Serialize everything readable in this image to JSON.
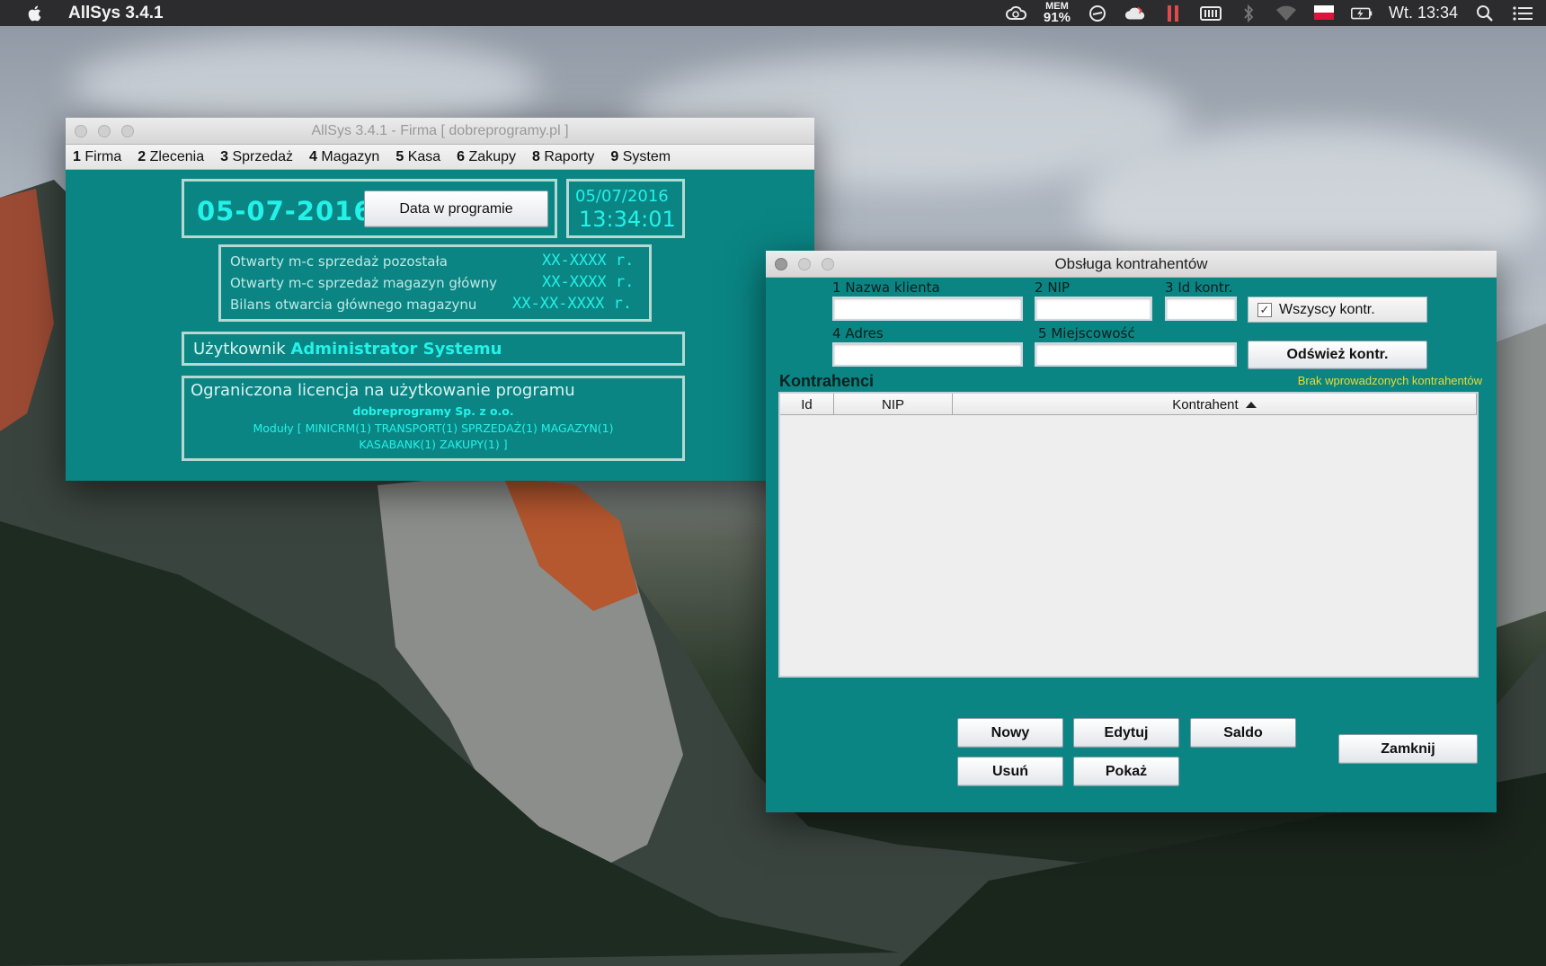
{
  "menubar": {
    "app_name": "AllSys 3.4.1",
    "mem_label": "MEM",
    "mem_value": "91%",
    "clock": "Wt. 13:34",
    "icons": [
      "apple-icon",
      "creative-cloud-icon",
      "sync-icon",
      "cloud-icon",
      "pause-icon",
      "battery-monitor-icon",
      "bluetooth-icon",
      "wifi-icon",
      "flag-icon",
      "battery-icon",
      "search-icon",
      "list-icon"
    ]
  },
  "main_window": {
    "title": "AllSys 3.4.1 - Firma [ dobreprogramy.pl ]",
    "menu": [
      {
        "num": "1",
        "label": "Firma"
      },
      {
        "num": "2",
        "label": "Zlecenia"
      },
      {
        "num": "3",
        "label": "Sprzedaż"
      },
      {
        "num": "4",
        "label": "Magazyn"
      },
      {
        "num": "5",
        "label": "Kasa"
      },
      {
        "num": "6",
        "label": "Zakupy"
      },
      {
        "num": "8",
        "label": "Raporty"
      },
      {
        "num": "9",
        "label": "System"
      }
    ],
    "program_date": "05-07-2016",
    "date_button": "Data w programie",
    "date_button_mnemonic": "D",
    "clock_date": "05/07/2016",
    "clock_time": "13:34:01",
    "status_rows": [
      {
        "label": "Otwarty m-c sprzedaż pozostała",
        "value": "XX-XXXX  r."
      },
      {
        "label": "Otwarty m-c sprzedaż magazyn główny",
        "value": "XX-XXXX  r."
      },
      {
        "label": "Bilans otwarcia głównego magazynu",
        "value": "XX-XX-XXXX  r."
      }
    ],
    "user_label": "Użytkownik",
    "user_name": "Administrator Systemu",
    "license_title": "Ograniczona licencja na użytkowanie programu",
    "license_company": "dobreprogramy Sp. z o.o.",
    "license_modules_1": "Moduły [ MINICRM(1) TRANSPORT(1) SPRZEDAŻ(1) MAGAZYN(1)",
    "license_modules_2": "KASABANK(1) ZAKUPY(1) ]"
  },
  "contractors_window": {
    "title": "Obsługa kontrahentów",
    "fields": {
      "name": {
        "num": "1",
        "label": "Nazwa klienta",
        "value": ""
      },
      "nip": {
        "num": "2",
        "label": "NIP",
        "value": ""
      },
      "id": {
        "num": "3",
        "label": "Id kontr.",
        "value": ""
      },
      "address": {
        "num": "4",
        "label": "Adres",
        "value": ""
      },
      "city": {
        "num": "5",
        "label": "Miejscowość",
        "value": ""
      }
    },
    "all_checkbox": {
      "label": "Wszyscy kontr.",
      "checked": true
    },
    "refresh_button": "Odśwież kontr.",
    "section_title": "Kontrahenci",
    "empty_message": "Brak wprowadzonych kontrahentów",
    "columns": [
      "Id",
      "NIP",
      "Kontrahent"
    ],
    "rows": [],
    "buttons": {
      "new": "Nowy",
      "edit": "Edytuj",
      "balance": "Saldo",
      "delete": "Usuń",
      "show": "Pokaż",
      "close": "Zamknij"
    }
  },
  "colors": {
    "window_bg": "#0a8584",
    "accent_cyan": "#23f2e9",
    "warning_yellow": "#f0d92a"
  }
}
